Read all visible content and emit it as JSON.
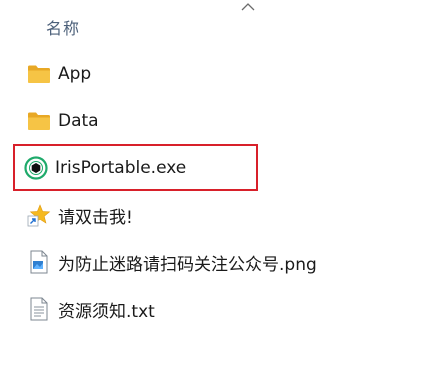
{
  "header": {
    "column_name": "名称"
  },
  "files": [
    {
      "name": "App",
      "icon": "folder-icon",
      "type": "folder"
    },
    {
      "name": "Data",
      "icon": "folder-icon",
      "type": "folder"
    },
    {
      "name": "IrisPortable.exe",
      "icon": "iris-app-icon",
      "type": "exe",
      "highlighted": true
    },
    {
      "name": "请双击我!",
      "icon": "shortcut-star-icon",
      "type": "shortcut"
    },
    {
      "name": "为防止迷路请扫码关注公众号.png",
      "icon": "image-file-icon",
      "type": "png"
    },
    {
      "name": "资源须知.txt",
      "icon": "text-file-icon",
      "type": "txt"
    }
  ],
  "colors": {
    "highlight_border": "#d8202a",
    "folder_yellow": "#f6c445",
    "iris_green": "#1faa6b"
  }
}
